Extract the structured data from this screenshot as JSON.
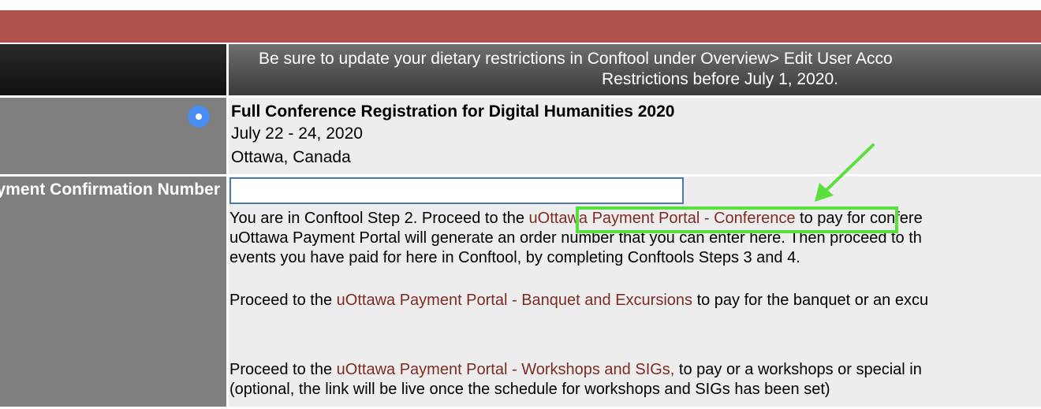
{
  "header": {
    "notice_line1": "Be sure to update your dietary restrictions in Conftool under Overview> Edit User Acco",
    "notice_line2": "Restrictions before July 1, 2020."
  },
  "registration": {
    "title": "Full Conference Registration for Digital Humanities 2020",
    "dates": "July 22 - 24, 2020",
    "location": "Ottawa, Canada",
    "selected": true
  },
  "confirmation": {
    "label": "Payment Confirmation Number",
    "value": ""
  },
  "instructions": {
    "p1_before": "You are in Conftool Step 2. Proceed to the ",
    "p1_link": "uOttawa Payment Portal - Conference",
    "p1_after": " to pay for confere",
    "p1_line2": "uOttawa Payment Portal will generate an order number that you can enter here. Then proceed to th",
    "p1_line3": "events you have paid for here in Conftool, by completing Conftools Steps 3 and 4.",
    "p2_before": "Proceed to the ",
    "p2_link": "uOttawa Payment Portal - Banquet and Excursions",
    "p2_after": " to pay for the banquet or an excu",
    "p3_before": "Proceed to the ",
    "p3_link": "uOttawa Payment Portal - Workshops and SIGs,",
    "p3_after": " to pay or a workshops or special in",
    "p3_line2": "(optional, the link will be live once the schedule for workshops and SIGs has been set)"
  },
  "colors": {
    "top_bar": "#b0524b",
    "link": "#7b2d24",
    "highlight": "#5ae03c",
    "radio": "#4a8ef3"
  },
  "icons": {
    "radio": "radio-selected-icon",
    "arrow": "annotation-arrow-icon"
  }
}
